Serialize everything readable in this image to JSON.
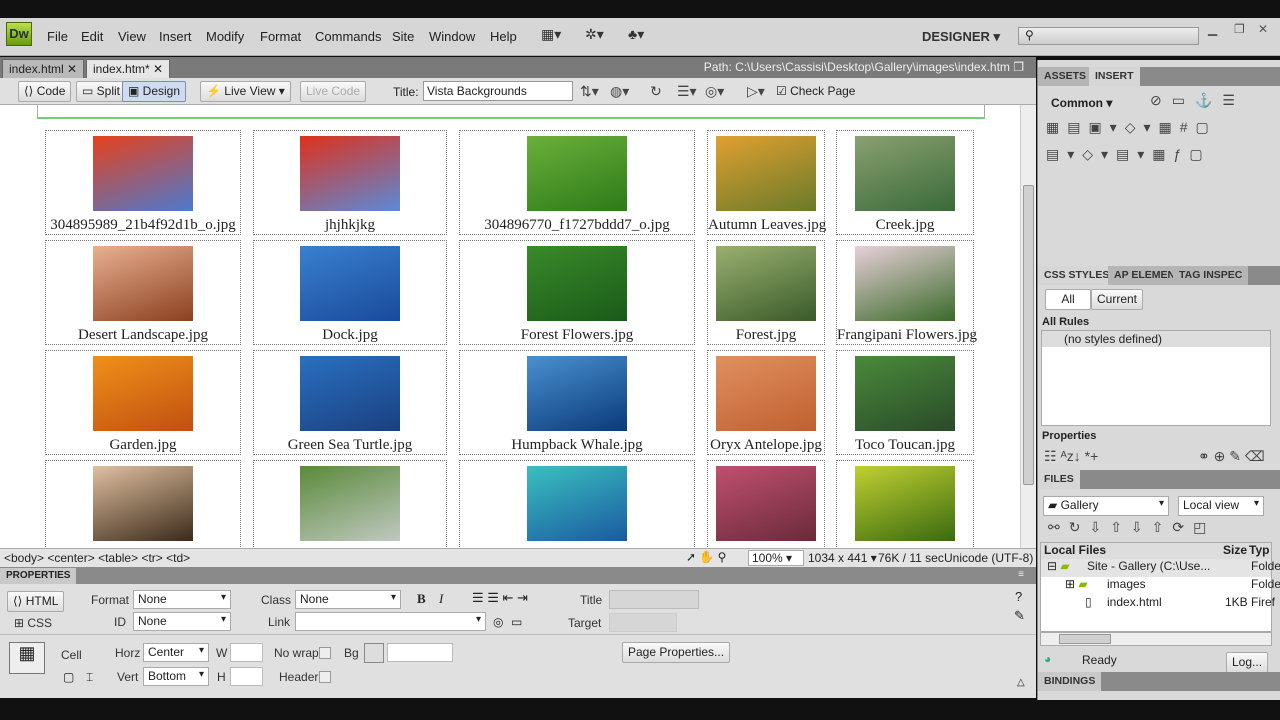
{
  "app": {
    "logo": "Dw",
    "menu": [
      "File",
      "Edit",
      "View",
      "Insert",
      "Modify",
      "Format",
      "Commands",
      "Site",
      "Window",
      "Help"
    ],
    "workspace": "DESIGNER"
  },
  "doc_tabs": [
    {
      "label": "index.html"
    },
    {
      "label": "index.htm*"
    }
  ],
  "path": "Path:  C:\\Users\\Cassisi\\Desktop\\Gallery\\images\\index.htm",
  "toolbar": {
    "code": "Code",
    "split": "Split",
    "design": "Design",
    "live_view": "Live View",
    "live_code": "Live Code",
    "title_label": "Title:",
    "title_value": "Vista Backgrounds",
    "check_page": "Check Page"
  },
  "gallery": [
    {
      "caption": "304895989_21b4f92d1b_o.jpg",
      "colors": [
        "#e8401a",
        "#4a7ad0"
      ]
    },
    {
      "caption": "jhjhkjkg",
      "colors": [
        "#e0301a",
        "#5a8ad8"
      ]
    },
    {
      "caption": "304896770_f1727bddd7_o.jpg",
      "colors": [
        "#6ab03a",
        "#2e7a1a"
      ]
    },
    {
      "caption": "Autumn Leaves.jpg",
      "colors": [
        "#e0a030",
        "#6a7a2a"
      ]
    },
    {
      "caption": "Creek.jpg",
      "colors": [
        "#8aa070",
        "#3a6a3a"
      ]
    },
    {
      "caption": "Desert Landscape.jpg",
      "colors": [
        "#e8b090",
        "#8a4020"
      ]
    },
    {
      "caption": "Dock.jpg",
      "colors": [
        "#3a80d0",
        "#1a4a9a"
      ]
    },
    {
      "caption": "Forest Flowers.jpg",
      "colors": [
        "#3a8a2a",
        "#1a5a1a"
      ]
    },
    {
      "caption": "Forest.jpg",
      "colors": [
        "#9ab070",
        "#3a5a2a"
      ]
    },
    {
      "caption": "Frangipani Flowers.jpg",
      "colors": [
        "#e8d0d8",
        "#3a6a2a"
      ]
    },
    {
      "caption": "Garden.jpg",
      "colors": [
        "#f0901a",
        "#c05010"
      ]
    },
    {
      "caption": "Green Sea Turtle.jpg",
      "colors": [
        "#2a70c0",
        "#1a4080"
      ]
    },
    {
      "caption": "Humpback Whale.jpg",
      "colors": [
        "#4a90d0",
        "#0a3a7a"
      ]
    },
    {
      "caption": "Oryx Antelope.jpg",
      "colors": [
        "#e09060",
        "#c06030"
      ]
    },
    {
      "caption": "Toco Toucan.jpg",
      "colors": [
        "#4a8a3a",
        "#2a4a2a"
      ]
    },
    {
      "caption": "",
      "colors": [
        "#e0c0a0",
        "#3a2a1a"
      ]
    },
    {
      "caption": "",
      "colors": [
        "#5a8a3a",
        "#c0c8c0"
      ]
    },
    {
      "caption": "",
      "colors": [
        "#3ac0c0",
        "#1a5aa0"
      ]
    },
    {
      "caption": "",
      "colors": [
        "#c05070",
        "#6a2a3a"
      ]
    },
    {
      "caption": "",
      "colors": [
        "#c0d030",
        "#3a6a10"
      ]
    }
  ],
  "status": {
    "tags": "<body> <center> <table> <tr> <td>",
    "zoom": "100%",
    "size": "1034 x 441",
    "download": "76K / 11 sec",
    "encoding": "Unicode (UTF-8)"
  },
  "properties": {
    "header": "PROPERTIES",
    "html": "HTML",
    "css": "CSS",
    "format_label": "Format",
    "format": "None",
    "id_label": "ID",
    "id": "None",
    "class_label": "Class",
    "class": "None",
    "link_label": "Link",
    "title_label": "Title",
    "target_label": "Target",
    "cell": "Cell",
    "horz_label": "Horz",
    "horz": "Center",
    "vert_label": "Vert",
    "vert": "Bottom",
    "w": "W",
    "h": "H",
    "nowrap": "No wrap",
    "bg": "Bg",
    "header_label": "Header",
    "page_props": "Page Properties..."
  },
  "panels": {
    "assets": "ASSETS",
    "insert": "INSERT",
    "category": "Common",
    "css_styles": "CSS STYLES",
    "ap": "AP ELEMENT",
    "tag": "TAG INSPEC",
    "all": "All",
    "current": "Current",
    "all_rules": "All Rules",
    "no_styles": "(no styles defined)",
    "properties": "Properties",
    "files": "FILES",
    "site": "Gallery",
    "view": "Local view",
    "local_files": "Local Files",
    "size": "Size",
    "type": "Typ",
    "tree": [
      {
        "name": "Site - Gallery (C:\\Use...",
        "size": "",
        "type": "Folde"
      },
      {
        "name": "images",
        "size": "",
        "type": "Folde"
      },
      {
        "name": "index.html",
        "size": "1KB",
        "type": "Firef"
      }
    ],
    "ready": "Ready",
    "log": "Log...",
    "bindings": "BINDINGS"
  }
}
